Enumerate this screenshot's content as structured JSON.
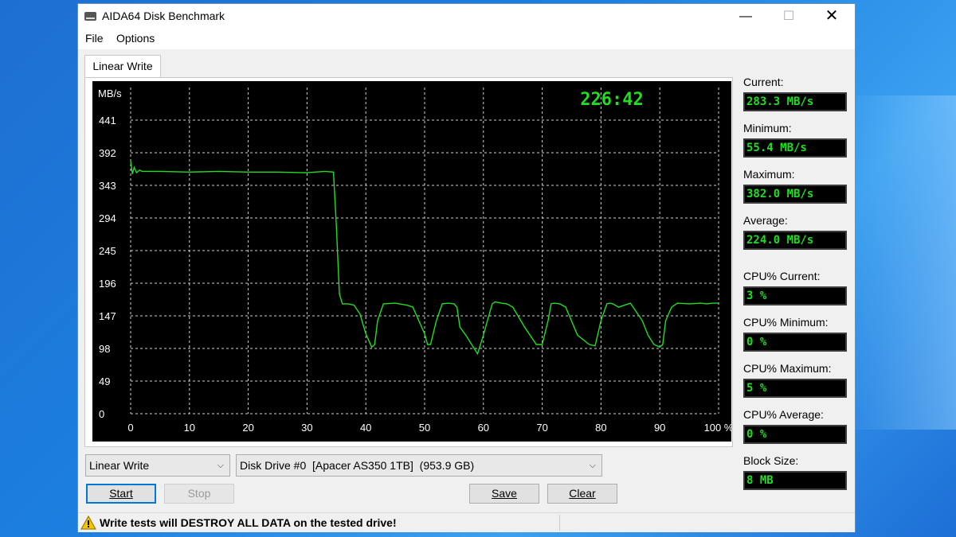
{
  "window": {
    "title": "AIDA64 Disk Benchmark",
    "controls": {
      "minimize": "—",
      "maximize": "☐",
      "close": "✕"
    }
  },
  "menu": {
    "file": "File",
    "options": "Options"
  },
  "tab": {
    "label": "Linear Write"
  },
  "stats": {
    "current_label": "Current:",
    "current_value": "283.3 MB/s",
    "minimum_label": "Minimum:",
    "minimum_value": "55.4 MB/s",
    "maximum_label": "Maximum:",
    "maximum_value": "382.0 MB/s",
    "average_label": "Average:",
    "average_value": "224.0 MB/s",
    "cpu_current_label": "CPU% Current:",
    "cpu_current_value": "3 %",
    "cpu_minimum_label": "CPU% Minimum:",
    "cpu_minimum_value": "0 %",
    "cpu_maximum_label": "CPU% Maximum:",
    "cpu_maximum_value": "5 %",
    "cpu_average_label": "CPU% Average:",
    "cpu_average_value": "0 %",
    "block_size_label": "Block Size:",
    "block_size_value": "8 MB"
  },
  "controls": {
    "mode_select": "Linear Write",
    "drive_select": "Disk Drive #0  [Apacer AS350 1TB]  (953.9 GB)",
    "start": "Start",
    "stop": "Stop",
    "save": "Save",
    "clear": "Clear"
  },
  "status": {
    "warning": "Write tests will DESTROY ALL DATA on the tested drive!"
  },
  "colors": {
    "plot_line": "#22dd22",
    "timer": "#22dd22",
    "grid": "#d0d0d0",
    "plot_bg": "#000000"
  },
  "chart_data": {
    "type": "line",
    "timer": "226:42",
    "ylabel": "MB/s",
    "yticks": [
      0,
      49,
      98,
      147,
      196,
      245,
      294,
      343,
      392,
      441
    ],
    "xticks": [
      "0",
      "10",
      "20",
      "30",
      "40",
      "50",
      "60",
      "70",
      "80",
      "90",
      "100 %"
    ],
    "ylim": [
      0,
      490
    ],
    "xlim": [
      0,
      100
    ],
    "grid": true,
    "series": [
      {
        "x": [
          0,
          0.3,
          0.6,
          1,
          1.5,
          2,
          5,
          10,
          15,
          20,
          25,
          30,
          33,
          34.5,
          35,
          35.5,
          36,
          37,
          38,
          39,
          40,
          41,
          41.5,
          42,
          43,
          45,
          47,
          48,
          50,
          50.5,
          51,
          52,
          53,
          54,
          55,
          55.5,
          56,
          57,
          58,
          59,
          60,
          61,
          61.5,
          62,
          63,
          64,
          65,
          67,
          69,
          70,
          71,
          71.5,
          72,
          73,
          74,
          76,
          78,
          79,
          80,
          81,
          81.5,
          82,
          83,
          85,
          87,
          88,
          89,
          90,
          90.5,
          91,
          92,
          93,
          95,
          97,
          98,
          99,
          100
        ],
        "y": [
          380,
          360,
          370,
          362,
          366,
          364,
          364,
          363,
          364,
          363,
          363,
          362,
          364,
          363,
          280,
          180,
          165,
          165,
          163,
          150,
          120,
          100,
          104,
          140,
          165,
          166,
          163,
          160,
          120,
          104,
          104,
          140,
          165,
          166,
          165,
          160,
          130,
          118,
          104,
          90,
          118,
          150,
          165,
          168,
          166,
          165,
          160,
          130,
          104,
          104,
          140,
          165,
          166,
          165,
          160,
          118,
          104,
          102,
          140,
          165,
          166,
          165,
          160,
          166,
          140,
          118,
          104,
          100,
          104,
          140,
          160,
          166,
          165,
          166,
          165,
          166,
          166
        ]
      }
    ]
  }
}
